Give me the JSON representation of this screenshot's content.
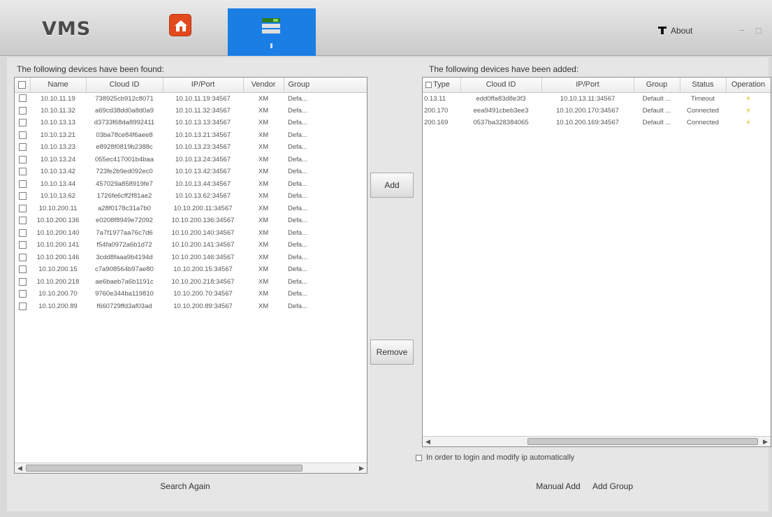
{
  "app": {
    "logo": "VMS"
  },
  "topbar": {
    "about_label": "About",
    "min_label": "−",
    "close_label": "□"
  },
  "found": {
    "caption": "The following devices have been found:",
    "headers": [
      "Name",
      "Cloud ID",
      "IP/Port",
      "Vendor",
      "Group"
    ],
    "rows": [
      [
        "10.10.11.19",
        "738925cb912c8071",
        "10.10.11.19:34567",
        "XM",
        "Defa..."
      ],
      [
        "10.10.11.32",
        "a69cd38dd0a8d0a9",
        "10.10.11.32:34567",
        "XM",
        "Defa..."
      ],
      [
        "10.10.13.13",
        "d3733f68da8992411",
        "10.10.13.13:34567",
        "XM",
        "Defa..."
      ],
      [
        "10.10.13.21",
        "03ba78ce84f6aee8",
        "10.10.13.21:34567",
        "XM",
        "Defa..."
      ],
      [
        "10.10.13.23",
        "e8928f0819b2388c",
        "10.10.13.23:34567",
        "XM",
        "Defa..."
      ],
      [
        "10.10.13.24",
        "055ec417001b4baa",
        "10.10.13.24:34567",
        "XM",
        "Defa..."
      ],
      [
        "10.10.13.42",
        "723fe2b9ed092ec0",
        "10.10.13.42:34567",
        "XM",
        "Defa..."
      ],
      [
        "10.10.13.44",
        "457029a858919fe7",
        "10.10.13.44:34567",
        "XM",
        "Defa..."
      ],
      [
        "10.10.13.62",
        "1726fe6cff2f81ae2",
        "10.10.13.62:34567",
        "XM",
        "Defa..."
      ],
      [
        "10.10.200.11",
        "a28f0178c31a7b0",
        "10.10.200.11:34567",
        "XM",
        "Defa..."
      ],
      [
        "10.10.200.136",
        "e0208f8949e72092",
        "10.10.200.136:34567",
        "XM",
        "Defa..."
      ],
      [
        "10.10.200.140",
        "7a7f1977aa76c7d6",
        "10.10.200.140:34567",
        "XM",
        "Defa..."
      ],
      [
        "10.10.200.141",
        "f54fa0972a6b1d72",
        "10.10.200.141:34567",
        "XM",
        "Defa..."
      ],
      [
        "10.10.200.146",
        "3cdd8faaa9b4194d",
        "10.10.200.146:34567",
        "XM",
        "Defa..."
      ],
      [
        "10.10.200.15",
        "c7a908564b97ae80",
        "10.10.200.15:34567",
        "XM",
        "Defa..."
      ],
      [
        "10.10.200.218",
        "ae6baeb7a6b1191c",
        "10.10.200.218:34567",
        "XM",
        "Defa..."
      ],
      [
        "10.10.200.70",
        "9760e344ba119810",
        "10.10.200.70:34567",
        "XM",
        "Defa..."
      ],
      [
        "10.10.200.89",
        "f660729ffd3af03ad",
        "10.10.200.89:34567",
        "XM",
        "Defa..."
      ]
    ]
  },
  "added": {
    "caption": "The following devices have been added:",
    "headers": [
      "Type",
      "Cloud ID",
      "IP/Port",
      "Group",
      "Status",
      "Operation"
    ],
    "rows": [
      [
        "0.13.11",
        "edd0ffa83d8e3f3",
        "10.10.13.11:34567",
        "Default ...",
        "Timeout",
        "⚡"
      ],
      [
        "200.170",
        "eea9491cbeb3ee3",
        "10.10.200.170:34567",
        "Default ...",
        "Connected",
        "⚡"
      ],
      [
        "200.169",
        "0537ba328384065",
        "10.10.200.169:34567",
        "Default ...",
        "Connected",
        "⚡"
      ]
    ]
  },
  "buttons": {
    "add": "Add",
    "remove": "Remove",
    "search_again": "Search Again",
    "manual_add": "Manual Add",
    "add_group": "Add Group"
  },
  "wizard_label": "In order to login and modify ip automatically"
}
